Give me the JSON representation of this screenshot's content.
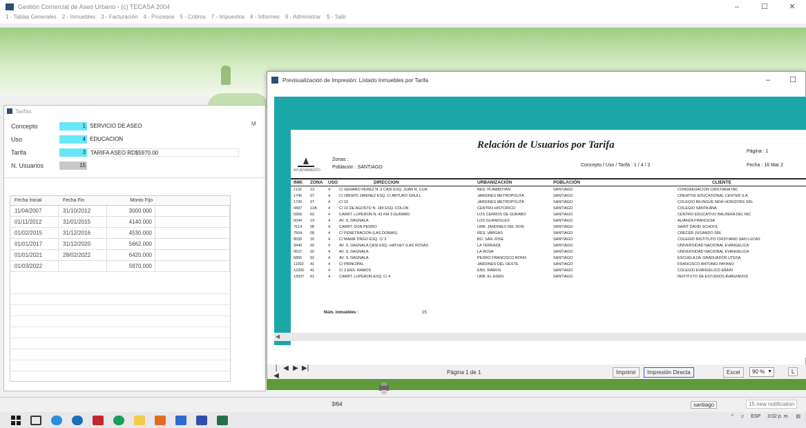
{
  "app": {
    "title": "Gestión Comercial de Aseo Urbano - (c) TECASA 2004",
    "controls": [
      "–",
      "☐",
      "✕"
    ],
    "menu": [
      "1 - Tablas Generales",
      "2 - Inmuebles",
      "3 - Facturación",
      "4 - Procesos",
      "5 - Cobros",
      "7 - Impuestos",
      "8 - Informes",
      "9 - Administrar",
      "S - Salir"
    ]
  },
  "tarifas_window": {
    "title": "Tarifas",
    "fields": [
      {
        "label": "Concepto",
        "code": "1",
        "desc": "SERVICIO DE ASEO"
      },
      {
        "label": "Uso",
        "code": "4",
        "desc": "EDUCACION"
      },
      {
        "label": "Tarifa",
        "code": "3",
        "desc": "TARIFA ASEO RD$5970.00"
      },
      {
        "label": "N. Usuarios",
        "code": "15",
        "desc": ""
      }
    ],
    "m_label": "M",
    "grid": {
      "headers": [
        "Fecha Inicial",
        "Fecha Fin",
        "Monto Fijo"
      ],
      "rows": [
        [
          "11/04/2007",
          "31/10/2012",
          "3000.000"
        ],
        [
          "01/11/2012",
          "31/01/2015",
          "4140.000"
        ],
        [
          "01/02/2015",
          "31/12/2016",
          "4530.000"
        ],
        [
          "01/01/2017",
          "31/12/2020",
          "5662.000"
        ],
        [
          "01/01/2021",
          "28/02/2022",
          "6420.000"
        ],
        [
          "01/03/2022",
          "",
          "5970.000"
        ]
      ]
    }
  },
  "preview_window": {
    "title": "Previsualización de Impresión: Listado Inmuebles por Tarifa",
    "controls": [
      "–",
      "☐"
    ],
    "toolbar": {
      "nav": [
        "|◀",
        "◀",
        "▶",
        "▶|"
      ],
      "page_of": "Página 1 de 1",
      "imprimir": "Imprimir",
      "impresion_directa": "Impresión Directa",
      "excel": "Excel",
      "zoom": "90 %",
      "extra": "L"
    },
    "report": {
      "title": "Relación de Usuarios por Tarifa",
      "logo_text": "AYUNTAMIENTO",
      "zonas": "Zonas :",
      "poblacion": "Población :   SANTIAGO",
      "concepto": "Concepto / Uso / Tarifa :    1 / 4 / 3",
      "pagina": "Página :    1",
      "fecha": "Fecha :    16 Mar 2",
      "headers": [
        "INM.",
        "ZONA",
        "USO",
        "DIRECCION",
        "URBANIZACIÓN",
        "POBLACIÓN",
        "CLIENTE"
      ],
      "rows": [
        [
          "1132",
          "13",
          "4",
          "C/ GENARO PEREZ N. 3 CASI ESQ. JUAN R. CUA",
          "RES. PLAMBOYAN",
          "SANTIAGO",
          "CONGREGACION CRISTIANA INC"
        ],
        [
          "1740",
          "07",
          "4",
          "C/ OBISPO JIMENEZ ESQ. C/ ARTURO GRULL",
          "JARDINES METROPOLITA",
          "SANTIAGO",
          "CREATIVE EDUCATIONAL CENTER S.A."
        ],
        [
          "1730",
          "07",
          "4",
          "C/ 10",
          "JARDINES METROPOLITA",
          "SANTIAGO",
          "COLEGIO BILINGUE NEW HORIZONS SRL"
        ],
        [
          "4497",
          "12A",
          "4",
          "C/ 16 DE AGOSTO N. 180 ESQ. COLON",
          "CENTRO HISTORICO",
          "SANTIAGO",
          "COLEGIO SANTA ANA"
        ],
        [
          "5956",
          "63",
          "4",
          "CARRT. LUPERON N. 43 KM 3 GURABO",
          "LOS CERROS DE GURABO",
          "SANTIAGO",
          "CENTRO EDUCATIVO BALDERA DEL INC"
        ],
        [
          "6044",
          "19",
          "4",
          "AV. S. DAGNALA",
          "LOS GUANDULES",
          "SANTIAGO",
          "ALIANZA FRANCESA"
        ],
        [
          "7514",
          "08",
          "4",
          "CARRT. DON PEDRO",
          "URB. JARDINES DEL DON",
          "SANTIAGO",
          "SAINT DAVID SCHOOL"
        ],
        [
          "7564",
          "08",
          "4",
          "C/ PENETRACION (LAS DOMAS)",
          "RES. VARGAS",
          "SANTIAGO",
          "CRECER JUGANDO SRL"
        ],
        [
          "8030",
          "16",
          "4",
          "C/ MAMA TINGO ESQ. C/ 3",
          "BO. SAN JOSE",
          "SANTIAGO",
          "COLEGIO INSTITUTO CRISTIANO SAN LUCAS"
        ],
        [
          "9440",
          "02",
          "4",
          "AV. S. DAGNALA CASI ESQ. HATUEY (LAS ROSAS",
          "LA TERRAZA",
          "SANTIAGO",
          "UNIVERSIDAD NACIONAL EVANGELICA"
        ],
        [
          "9537",
          "02",
          "4",
          "AV. S. DAGNALA",
          "LA ROSA",
          "SANTIAGO",
          "UNIVERSIDAD NACIONAL EVANGELICA"
        ],
        [
          "5856",
          "02",
          "4",
          "AV. S. DAGNALA",
          "PEDRO FRANCISCO BONO",
          "SANTIAGO",
          "ESCUELA DE GRADUADOS UTESA"
        ],
        [
          "11932",
          "41",
          "4",
          "C/ PRINCIPAL",
          "JARDINES DEL OESTE",
          "SANTIAGO",
          "FRANCISCO ANTONIO PAYANO"
        ],
        [
          "12200",
          "41",
          "4",
          "C/ 3 ENS. RAMOS",
          "ENS. RAMOS",
          "SANTIAGO",
          "COLEGIO EVANGELICO EBAIN"
        ],
        [
          "13037",
          "61",
          "4",
          "CARRT. LUPERON ESQ. C/ 4",
          "URB. EL EDEN",
          "SANTIAGO",
          "INSTITUTO DE ESTUDIOS AVANZADOS"
        ]
      ],
      "total_label": "Núm. inmuebles :",
      "total_value": "15"
    }
  },
  "status_bar": {
    "count": "3/64",
    "user": "santiago",
    "notifications": "15 new notification"
  },
  "taskbar": {
    "lang": "ESP",
    "time": "3:02 p. m."
  },
  "colors": {
    "banner_green": "#9fcd82",
    "preview_canvas": "#1ba7a8",
    "code_cyan": "#66e8f8"
  }
}
